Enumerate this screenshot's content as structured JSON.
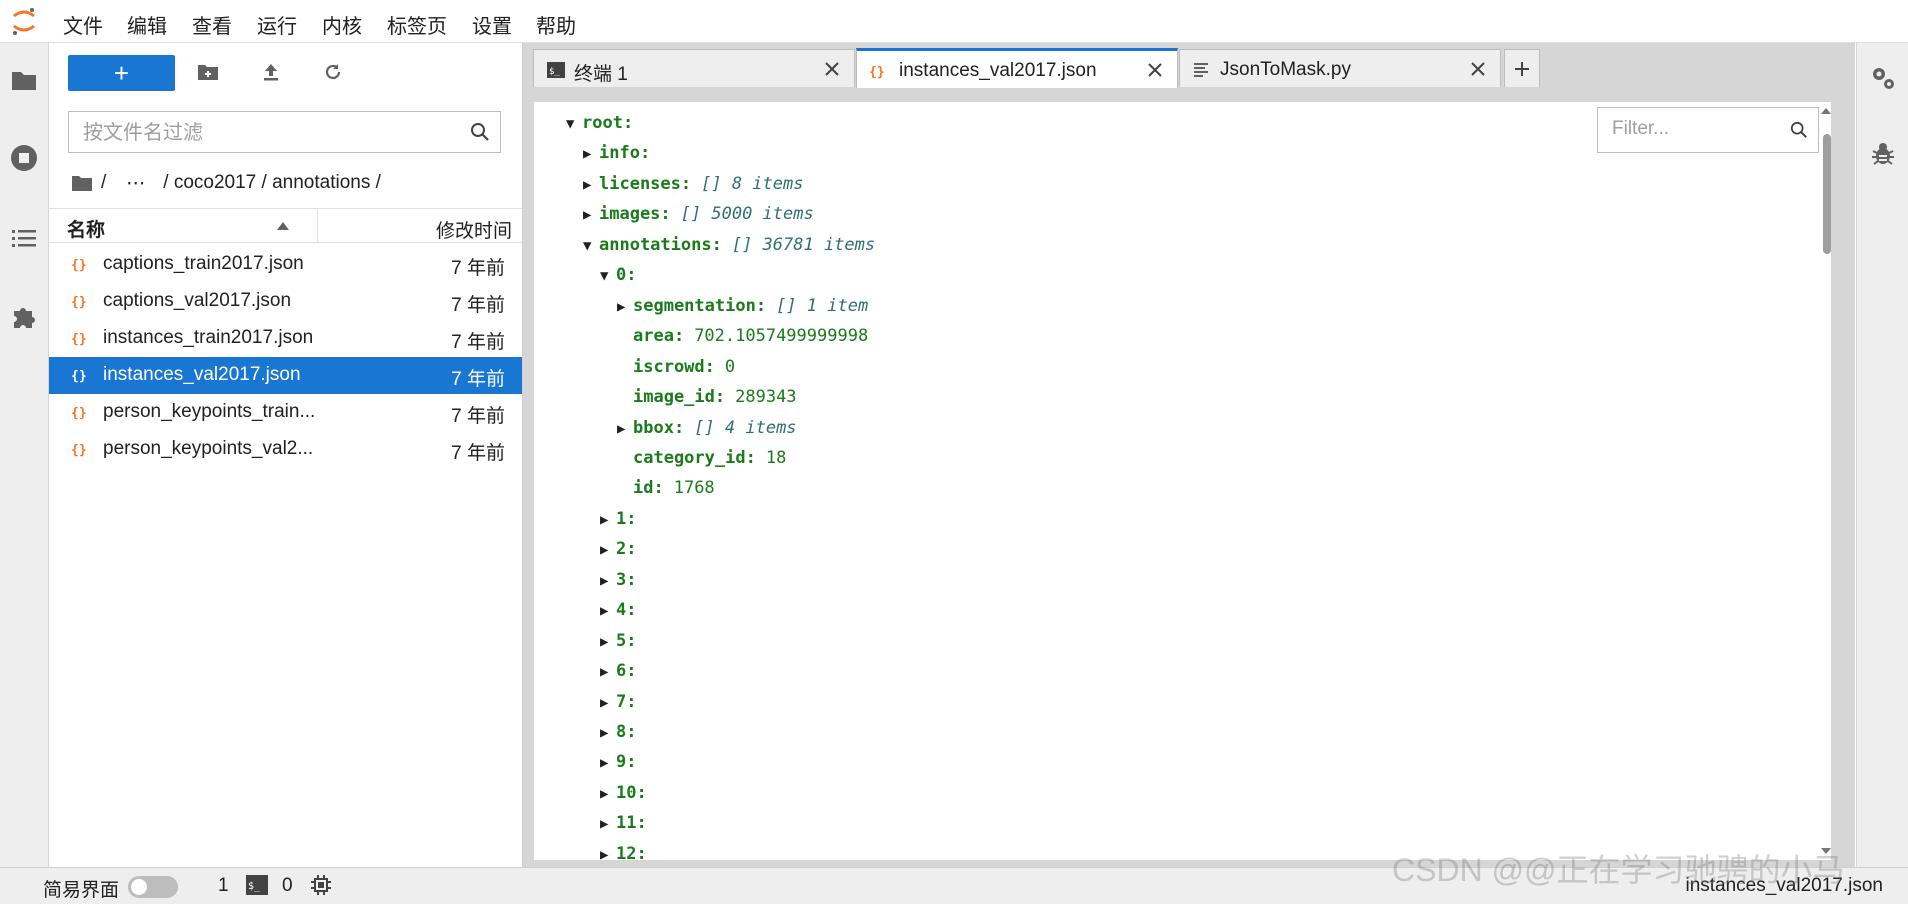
{
  "menu": {
    "items": [
      "文件",
      "编辑",
      "查看",
      "运行",
      "内核",
      "标签页",
      "设置",
      "帮助"
    ]
  },
  "sidebar_left": {
    "icons": [
      "folder-icon",
      "running-icon",
      "toc-icon",
      "extension-icon"
    ]
  },
  "filebrowser": {
    "new_label": "+",
    "filter_placeholder": "按文件名过滤",
    "breadcrumb": [
      "/",
      "⋯",
      "/ coco2017 / annotations /"
    ],
    "columns": {
      "name": "名称",
      "modified": "修改时间"
    },
    "files": [
      {
        "name": "captions_train2017.json",
        "modified": "7 年前",
        "selected": false
      },
      {
        "name": "captions_val2017.json",
        "modified": "7 年前",
        "selected": false
      },
      {
        "name": "instances_train2017.json",
        "modified": "7 年前",
        "selected": false
      },
      {
        "name": "instances_val2017.json",
        "modified": "7 年前",
        "selected": true
      },
      {
        "name": "person_keypoints_train...",
        "modified": "7 年前",
        "selected": false
      },
      {
        "name": "person_keypoints_val2...",
        "modified": "7 年前",
        "selected": false
      }
    ]
  },
  "tabs": [
    {
      "label": "终端 1",
      "icon": "terminal-icon",
      "active": false
    },
    {
      "label": "instances_val2017.json",
      "icon": "json-icon",
      "active": true
    },
    {
      "label": "JsonToMask.py",
      "icon": "text-file-icon",
      "active": false
    }
  ],
  "json_viewer": {
    "filter_placeholder": "Filter...",
    "rows": [
      {
        "depth": 0,
        "toggle": "▼",
        "key": "root:",
        "type": "",
        "value": ""
      },
      {
        "depth": 1,
        "toggle": "▶",
        "key": "info:",
        "type": "",
        "value": ""
      },
      {
        "depth": 1,
        "toggle": "▶",
        "key": "licenses:",
        "type": "[] 8 items",
        "value": ""
      },
      {
        "depth": 1,
        "toggle": "▶",
        "key": "images:",
        "type": "[] 5000 items",
        "value": ""
      },
      {
        "depth": 1,
        "toggle": "▼",
        "key": "annotations:",
        "type": "[] 36781 items",
        "value": ""
      },
      {
        "depth": 2,
        "toggle": "▼",
        "key": "0:",
        "type": "",
        "value": ""
      },
      {
        "depth": 3,
        "toggle": "▶",
        "key": "segmentation:",
        "type": "[] 1 item",
        "value": ""
      },
      {
        "depth": 3,
        "toggle": "",
        "key": "area:",
        "type": "",
        "value": "702.1057499999998"
      },
      {
        "depth": 3,
        "toggle": "",
        "key": "iscrowd:",
        "type": "",
        "value": "0"
      },
      {
        "depth": 3,
        "toggle": "",
        "key": "image_id:",
        "type": "",
        "value": "289343"
      },
      {
        "depth": 3,
        "toggle": "▶",
        "key": "bbox:",
        "type": "[] 4 items",
        "value": ""
      },
      {
        "depth": 3,
        "toggle": "",
        "key": "category_id:",
        "type": "",
        "value": "18"
      },
      {
        "depth": 3,
        "toggle": "",
        "key": "id:",
        "type": "",
        "value": "1768"
      },
      {
        "depth": 2,
        "toggle": "▶",
        "key": "1:",
        "type": "",
        "value": ""
      },
      {
        "depth": 2,
        "toggle": "▶",
        "key": "2:",
        "type": "",
        "value": ""
      },
      {
        "depth": 2,
        "toggle": "▶",
        "key": "3:",
        "type": "",
        "value": ""
      },
      {
        "depth": 2,
        "toggle": "▶",
        "key": "4:",
        "type": "",
        "value": ""
      },
      {
        "depth": 2,
        "toggle": "▶",
        "key": "5:",
        "type": "",
        "value": ""
      },
      {
        "depth": 2,
        "toggle": "▶",
        "key": "6:",
        "type": "",
        "value": ""
      },
      {
        "depth": 2,
        "toggle": "▶",
        "key": "7:",
        "type": "",
        "value": ""
      },
      {
        "depth": 2,
        "toggle": "▶",
        "key": "8:",
        "type": "",
        "value": ""
      },
      {
        "depth": 2,
        "toggle": "▶",
        "key": "9:",
        "type": "",
        "value": ""
      },
      {
        "depth": 2,
        "toggle": "▶",
        "key": "10:",
        "type": "",
        "value": ""
      },
      {
        "depth": 2,
        "toggle": "▶",
        "key": "11:",
        "type": "",
        "value": ""
      },
      {
        "depth": 2,
        "toggle": "▶",
        "key": "12:",
        "type": "",
        "value": ""
      }
    ]
  },
  "sidebar_right": {
    "icons": [
      "property-inspector-icon",
      "debugger-icon"
    ]
  },
  "statusbar": {
    "simple_mode_label": "简易界面",
    "terminal_count": "1",
    "kernel_count": "0",
    "current_file": "instances_val2017.json"
  },
  "watermark": "CSDN @@正在学习驰骋的小马",
  "colors": {
    "accent": "#1976d2",
    "json_key": "#1b7a1b",
    "json_type": "#2e6f6f",
    "jupyter_orange": "#f37726"
  }
}
